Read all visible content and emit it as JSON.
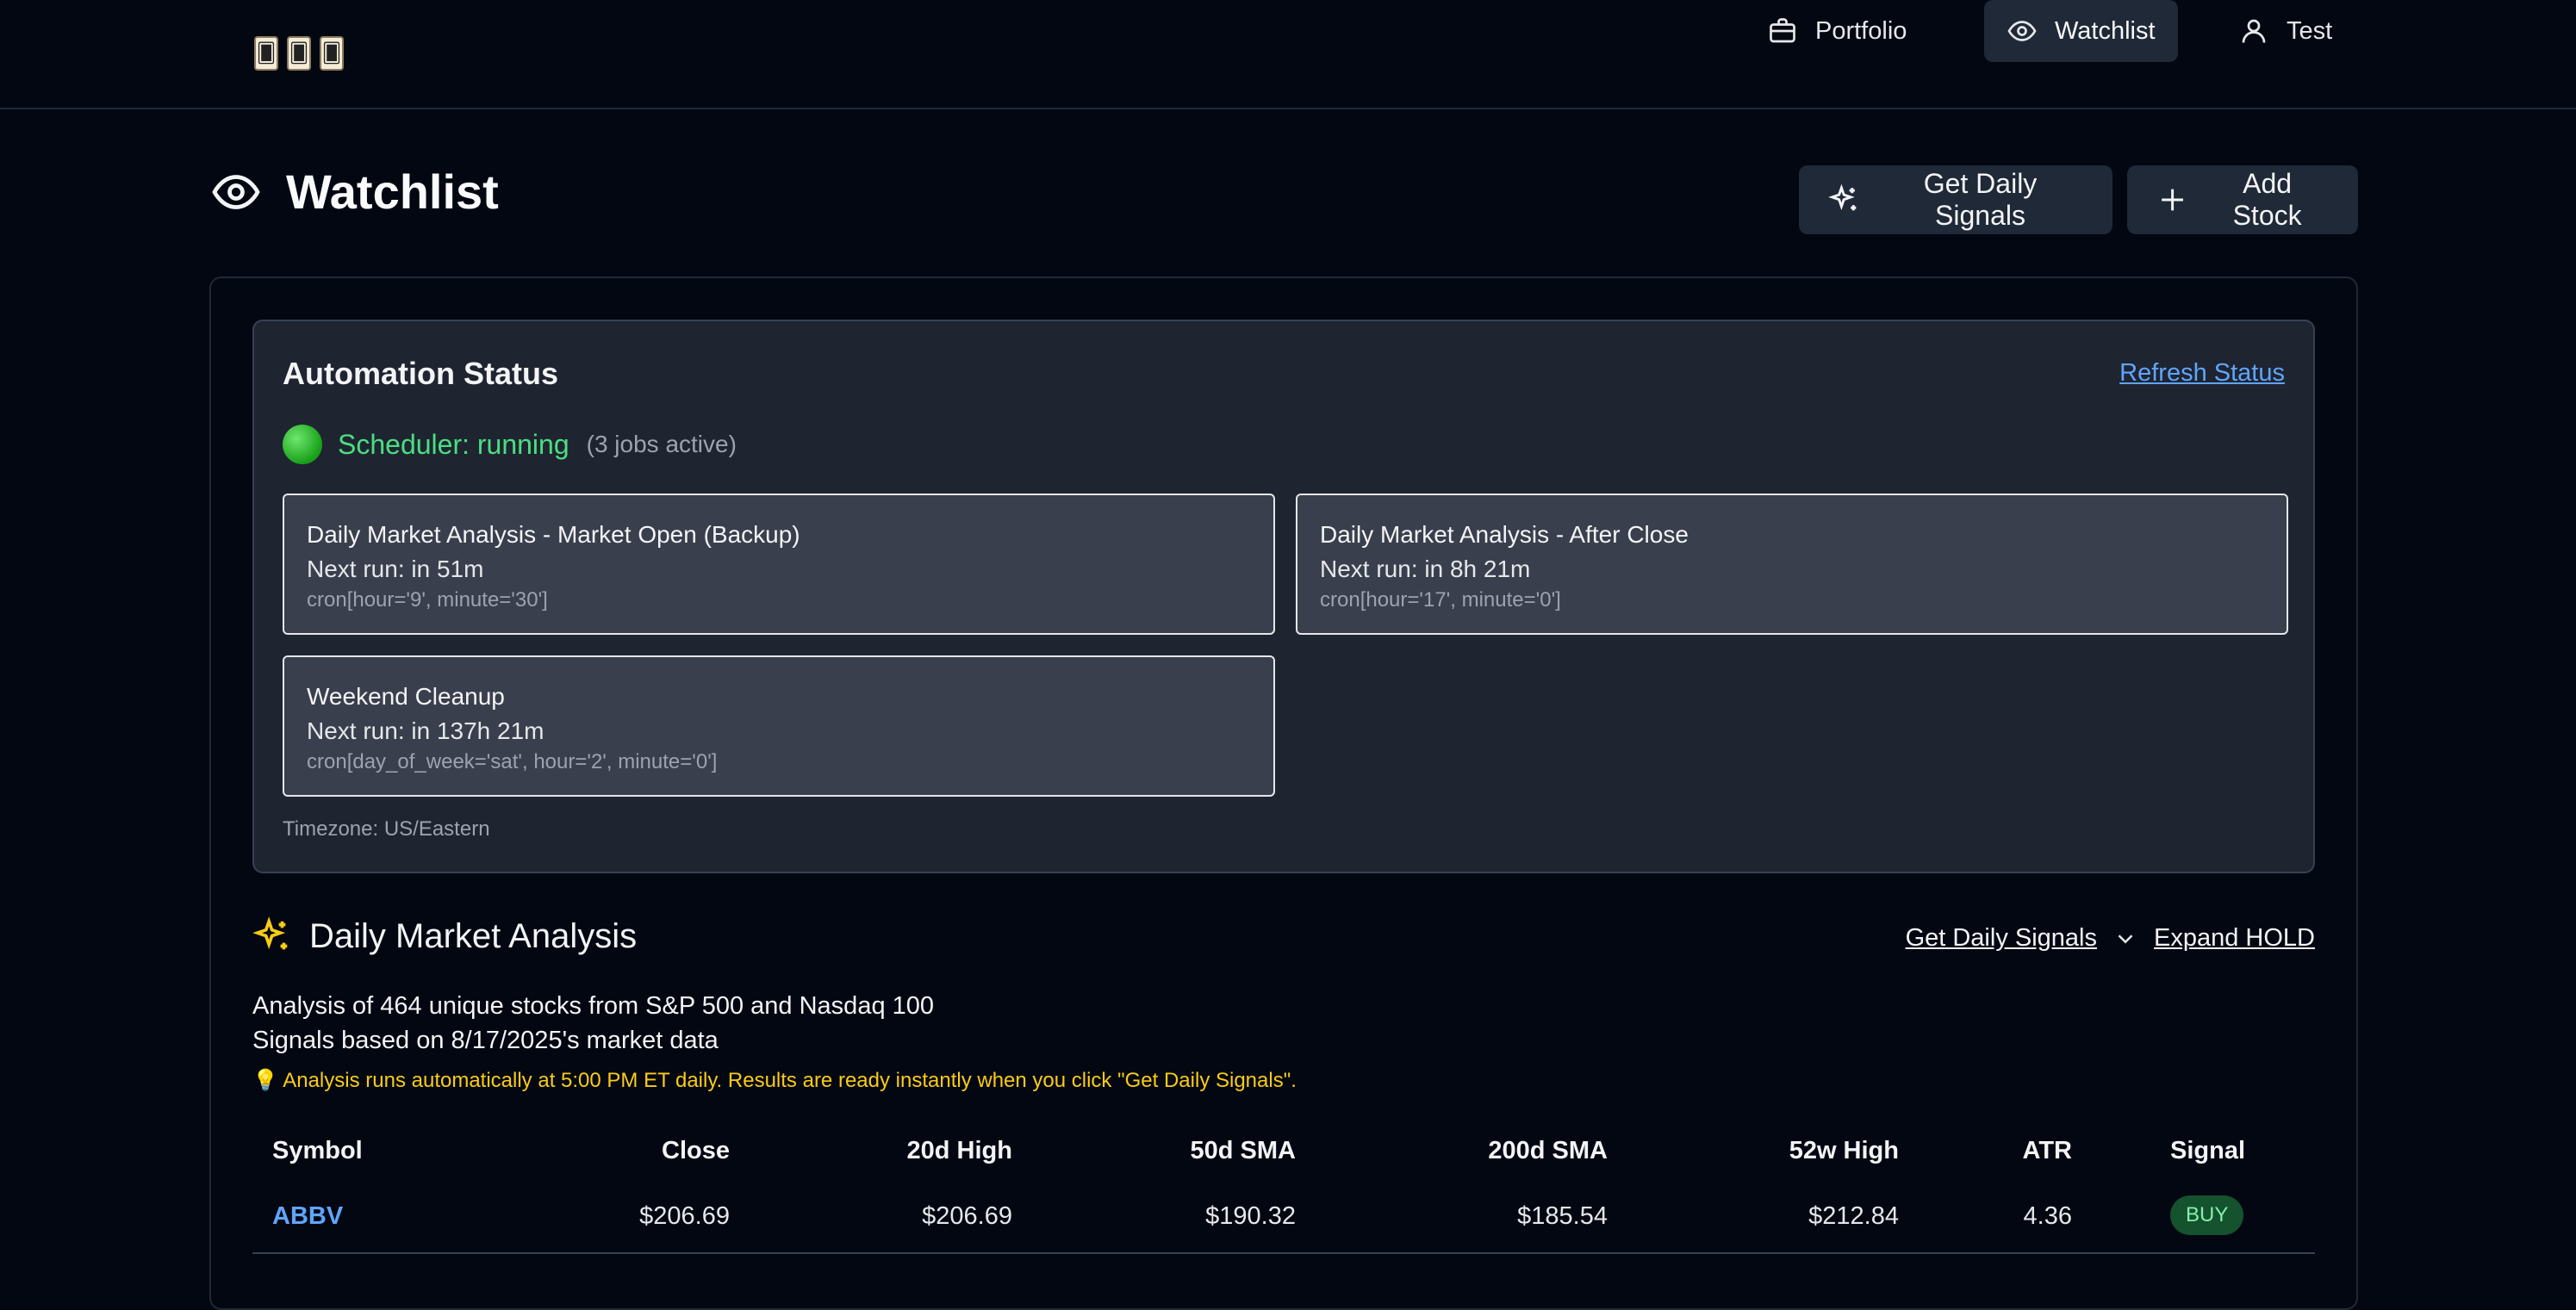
{
  "nav": {
    "logo_glyphs": [
      "🂠",
      "🂠",
      "🂠"
    ],
    "items": [
      {
        "label": "Portfolio",
        "icon": "briefcase-icon",
        "active": false
      },
      {
        "label": "Watchlist",
        "icon": "eye-icon",
        "active": true
      },
      {
        "label": "Test",
        "icon": "user-icon",
        "active": false
      }
    ]
  },
  "page": {
    "title": "Watchlist",
    "get_signals_label": "Get Daily Signals",
    "add_stock_label": "Add Stock"
  },
  "automation": {
    "title": "Automation Status",
    "refresh_label": "Refresh Status",
    "scheduler_status": "Scheduler: running",
    "jobs_active": "(3 jobs active)",
    "jobs": [
      {
        "name": "Daily Market Analysis - Market Open (Backup)",
        "next_run": "Next run: in 51m",
        "cron": "cron[hour='9', minute='30']"
      },
      {
        "name": "Daily Market Analysis - After Close",
        "next_run": "Next run: in 8h 21m",
        "cron": "cron[hour='17', minute='0']"
      },
      {
        "name": "Weekend Cleanup",
        "next_run": "Next run: in 137h 21m",
        "cron": "cron[day_of_week='sat', hour='2', minute='0']"
      }
    ],
    "timezone": "Timezone: US/Eastern"
  },
  "analysis": {
    "title": "Daily Market Analysis",
    "get_signals_link": "Get Daily Signals",
    "expand_hold_link": "Expand HOLD",
    "summary_line": "Analysis of 464 unique stocks from S&P 500 and Nasdaq 100",
    "signals_line": "Signals based on 8/17/2025's market data",
    "tip": "💡 Analysis runs automatically at 5:00 PM ET daily. Results are ready instantly when you click \"Get Daily Signals\"."
  },
  "table": {
    "headers": [
      "Symbol",
      "Close",
      "20d High",
      "50d SMA",
      "200d SMA",
      "52w High",
      "ATR",
      "Signal"
    ],
    "rows": [
      {
        "symbol": "ABBV",
        "close": "$206.69",
        "high20": "$206.69",
        "sma50": "$190.32",
        "sma200": "$185.54",
        "high52": "$212.84",
        "atr": "4.36",
        "signal": "BUY"
      }
    ]
  },
  "colors": {
    "background": "#030712",
    "panel": "#1f2431",
    "accent_blue": "#60a5fa",
    "running_green": "#4ade80",
    "tip_yellow": "#facc15",
    "buy_badge": "#14532d"
  }
}
